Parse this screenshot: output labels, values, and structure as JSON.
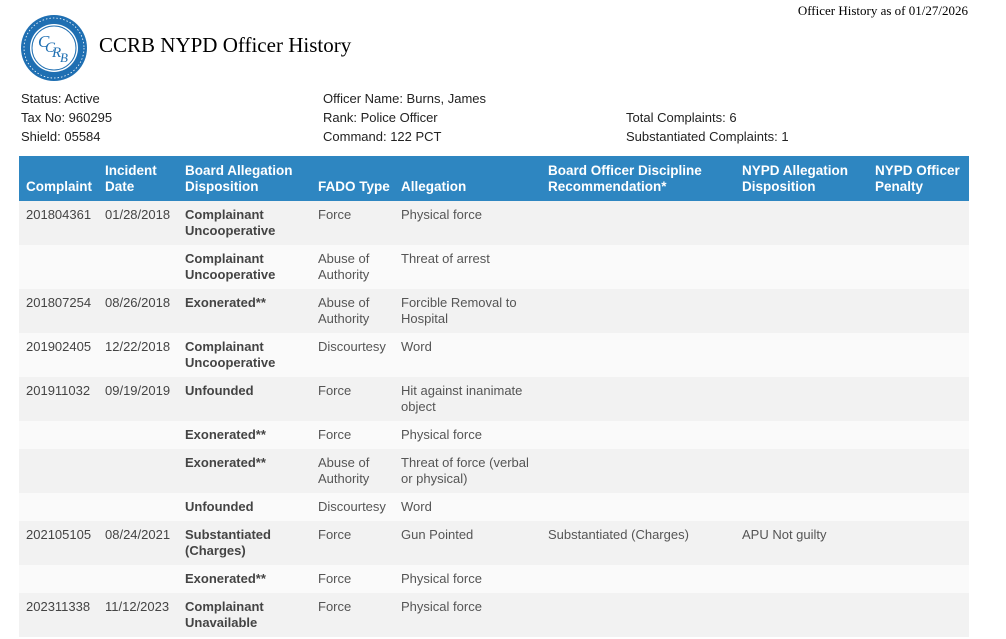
{
  "header": {
    "as_of": "Officer History as of 01/27/2026",
    "title": "CCRB NYPD Officer History",
    "seal_text": "CCRB"
  },
  "officer": {
    "status": "Status: Active",
    "tax_no": "Tax No: 960295",
    "shield": "Shield: 05584",
    "name": "Officer Name: Burns, James",
    "rank": "Rank: Police Officer",
    "command": "Command: 122 PCT",
    "total_complaints": "Total Complaints: 6",
    "substantiated_complaints": "Substantiated Complaints: 1"
  },
  "table": {
    "headers": {
      "complaint": "Complaint",
      "incident_date": "Incident Date",
      "board_disposition": "Board Allegation Disposition",
      "fado_type": "FADO Type",
      "allegation": "Allegation",
      "board_recommendation": "Board Officer Discipline Recommendation*",
      "nypd_disposition": "NYPD Allegation Disposition",
      "nypd_penalty": "NYPD Officer Penalty"
    },
    "rows": [
      {
        "complaint": "201804361",
        "date": "01/28/2018",
        "disposition": "Complainant Uncooperative",
        "fado": "Force",
        "allegation": "Physical force",
        "recommendation": "",
        "nypd_disposition": "",
        "penalty": ""
      },
      {
        "complaint": "",
        "date": "",
        "disposition": "Complainant Uncooperative",
        "fado": "Abuse of Authority",
        "allegation": "Threat of arrest",
        "recommendation": "",
        "nypd_disposition": "",
        "penalty": ""
      },
      {
        "complaint": "201807254",
        "date": "08/26/2018",
        "disposition": "Exonerated**",
        "fado": "Abuse of Authority",
        "allegation": "Forcible Removal to Hospital",
        "recommendation": "",
        "nypd_disposition": "",
        "penalty": ""
      },
      {
        "complaint": "201902405",
        "date": "12/22/2018",
        "disposition": "Complainant Uncooperative",
        "fado": "Discourtesy",
        "allegation": "Word",
        "recommendation": "",
        "nypd_disposition": "",
        "penalty": ""
      },
      {
        "complaint": "201911032",
        "date": "09/19/2019",
        "disposition": "Unfounded",
        "fado": "Force",
        "allegation": "Hit against inanimate object",
        "recommendation": "",
        "nypd_disposition": "",
        "penalty": ""
      },
      {
        "complaint": "",
        "date": "",
        "disposition": "Exonerated**",
        "fado": "Force",
        "allegation": "Physical force",
        "recommendation": "",
        "nypd_disposition": "",
        "penalty": ""
      },
      {
        "complaint": "",
        "date": "",
        "disposition": "Exonerated**",
        "fado": "Abuse of Authority",
        "allegation": "Threat of force (verbal or physical)",
        "recommendation": "",
        "nypd_disposition": "",
        "penalty": ""
      },
      {
        "complaint": "",
        "date": "",
        "disposition": "Unfounded",
        "fado": "Discourtesy",
        "allegation": "Word",
        "recommendation": "",
        "nypd_disposition": "",
        "penalty": ""
      },
      {
        "complaint": "202105105",
        "date": "08/24/2021",
        "disposition": "Substantiated (Charges)",
        "fado": "Force",
        "allegation": "Gun Pointed",
        "recommendation": "Substantiated (Charges)",
        "nypd_disposition": "APU Not guilty",
        "penalty": ""
      },
      {
        "complaint": "",
        "date": "",
        "disposition": "Exonerated**",
        "fado": "Force",
        "allegation": "Physical force",
        "recommendation": "",
        "nypd_disposition": "",
        "penalty": ""
      },
      {
        "complaint": "202311338",
        "date": "11/12/2023",
        "disposition": "Complainant Unavailable",
        "fado": "Force",
        "allegation": "Physical force",
        "recommendation": "",
        "nypd_disposition": "",
        "penalty": ""
      }
    ]
  },
  "colors": {
    "header_bg": "#2e86c1",
    "row_odd": "#f2f2f2",
    "row_even": "#fafafa",
    "seal_blue": "#1f6fb2"
  }
}
